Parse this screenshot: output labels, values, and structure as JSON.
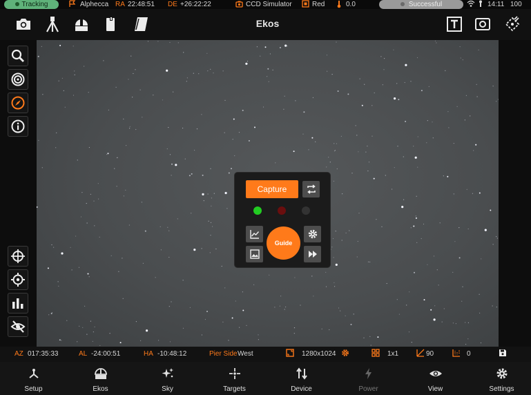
{
  "statusbar": {
    "tracking": "Tracking",
    "target_name": "Alphecca",
    "ra_label": "RA",
    "ra_value": "22:48:51",
    "de_label": "DE",
    "de_value": "+26:22:22",
    "camera": "CCD Simulator",
    "filter": "Red",
    "temperature": "0.0",
    "status": "Successful",
    "time": "14:11",
    "battery": "100"
  },
  "toolbar": {
    "title": "Ekos"
  },
  "panel": {
    "capture_label": "Capture",
    "guide_label": "Guide"
  },
  "infobar": {
    "az_label": "AZ",
    "az_value": "017:35:33",
    "al_label": "AL",
    "al_value": "-24:00:51",
    "ha_label": "HA",
    "ha_value": "-10:48:12",
    "pier_label": "Pier Side",
    "pier_value": "West",
    "resolution": "1280x1024",
    "binning": "1x1",
    "exposure": "90",
    "count": "0"
  },
  "nav": [
    {
      "label": "Setup",
      "icon": "setup-icon"
    },
    {
      "label": "Ekos",
      "icon": "ekos-icon"
    },
    {
      "label": "Sky",
      "icon": "sky-icon"
    },
    {
      "label": "Targets",
      "icon": "targets-icon"
    },
    {
      "label": "Device",
      "icon": "device-icon"
    },
    {
      "label": "Power",
      "icon": "power-icon"
    },
    {
      "label": "View",
      "icon": "view-icon"
    },
    {
      "label": "Settings",
      "icon": "settings-icon"
    }
  ],
  "colors": {
    "accent": "#ff7a1a",
    "tracking": "#5fb27a",
    "led_green": "#22cc22",
    "led_red": "#6a0e0e",
    "led_off": "#333333"
  }
}
